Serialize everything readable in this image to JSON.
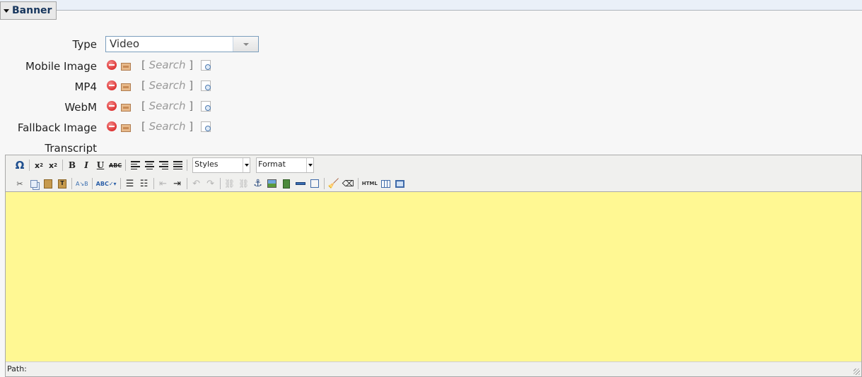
{
  "fieldset": {
    "legend": "Banner"
  },
  "fields": {
    "type": {
      "label": "Type",
      "value": "Video"
    },
    "mobile_image": {
      "label": "Mobile Image",
      "search": "Search"
    },
    "mp4": {
      "label": "MP4",
      "search": "Search"
    },
    "webm": {
      "label": "WebM",
      "search": "Search"
    },
    "fallback_image": {
      "label": "Fallback Image",
      "search": "Search"
    },
    "transcript": {
      "label": "Transcript"
    }
  },
  "editor": {
    "styles_combo": "Styles",
    "format_combo": "Format",
    "status_path": "Path:",
    "content_bg": "#fff893",
    "toolbar_row1_icons": [
      "special-character",
      "subscript",
      "superscript",
      "bold",
      "italic",
      "underline",
      "strikethrough",
      "align-left",
      "align-center",
      "align-right",
      "justify"
    ],
    "toolbar_row2_icons": [
      "cut",
      "copy",
      "paste",
      "paste-text",
      "replace",
      "spellcheck",
      "bullet-list",
      "numbered-list",
      "outdent",
      "indent",
      "undo",
      "redo",
      "link",
      "unlink",
      "anchor",
      "image",
      "media",
      "horizontal-rule",
      "edit-attributes",
      "cleanup",
      "remove-format",
      "html-source",
      "table",
      "fullscreen"
    ]
  }
}
